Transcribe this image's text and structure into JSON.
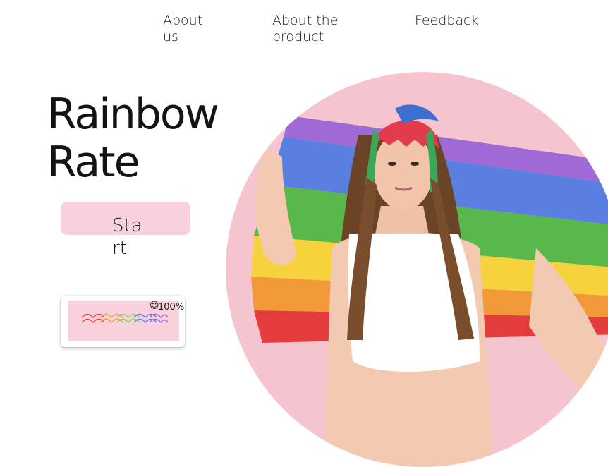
{
  "nav": {
    "about_us": "About us",
    "about_product": "About the product",
    "feedback": "Feedback"
  },
  "hero": {
    "title_line1": "Rainbow",
    "title_line2": "Rate",
    "start_label": "Start",
    "image": "woman-holding-rainbow-flag-photo"
  },
  "rate_card": {
    "icon": "smiley-icon",
    "value": "100%"
  },
  "colors": {
    "pink": "#f9d1dc",
    "photo_background": "#f6c4cf",
    "text": "#161212"
  }
}
